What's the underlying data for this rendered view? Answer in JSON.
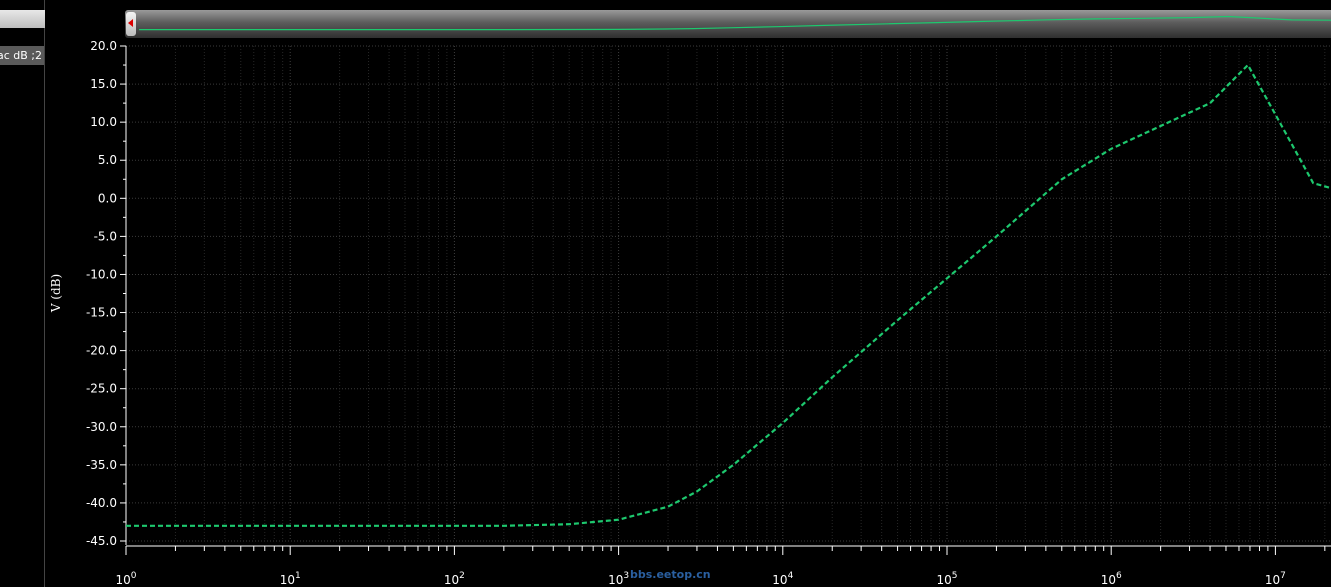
{
  "trace_label": "2; ac dB",
  "chart_data": {
    "type": "line",
    "xscale": "log",
    "xlim": [
      1,
      30000000
    ],
    "ylim": [
      -45,
      20
    ],
    "grid": true,
    "ylabel": "V (dB)",
    "yticks": [
      "20.0",
      "15.0",
      "10.0",
      "5.0",
      "0.0",
      "-5.0",
      "-10.0",
      "-15.0",
      "-20.0",
      "-25.0",
      "-30.0",
      "-35.0",
      "-40.0",
      "-45.0"
    ],
    "xticks": [
      {
        "base": "10",
        "exp": "0"
      },
      {
        "base": "10",
        "exp": "1"
      },
      {
        "base": "10",
        "exp": "2"
      },
      {
        "base": "10",
        "exp": "3"
      },
      {
        "base": "10",
        "exp": "4"
      },
      {
        "base": "10",
        "exp": "5"
      },
      {
        "base": "10",
        "exp": "6"
      },
      {
        "base": "10",
        "exp": "7"
      }
    ],
    "series": [
      {
        "color": "#1dc86e",
        "style": "dashed",
        "x": [
          1,
          10,
          100,
          200,
          500,
          1000,
          2000,
          3000,
          5000,
          10000,
          20000,
          50000,
          100000,
          200000,
          500000,
          1000000,
          2000000,
          4000000,
          6800000,
          10000000,
          17000000,
          30000000
        ],
        "y": [
          -43.0,
          -43.0,
          -43.0,
          -43.0,
          -42.8,
          -42.2,
          -40.5,
          -38.5,
          -35.0,
          -29.5,
          -23.5,
          -16.0,
          -10.5,
          -5.0,
          2.5,
          6.5,
          9.5,
          12.5,
          17.5,
          11.0,
          2.0,
          0.5
        ]
      }
    ]
  },
  "watermark": "bbs.eetop.cn"
}
